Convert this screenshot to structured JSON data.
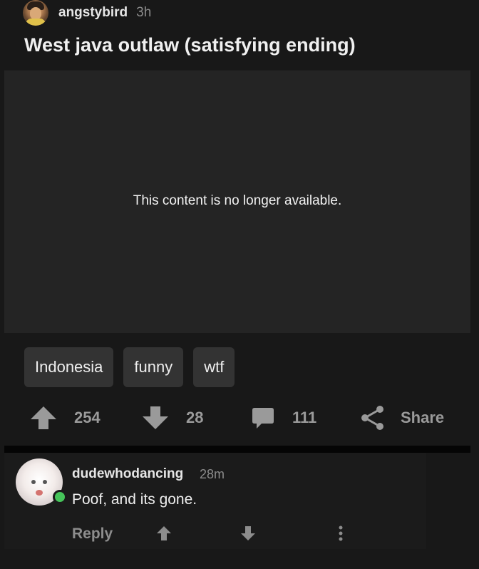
{
  "post": {
    "author": "angstybird",
    "time": "3h",
    "title": "West java outlaw (satisfying ending)",
    "media_message": "This content is no longer available.",
    "tags": [
      "Indonesia",
      "funny",
      "wtf"
    ],
    "upvotes": "254",
    "downvotes": "28",
    "comments": "111",
    "share_label": "Share"
  },
  "comment": {
    "author": "dudewhodancing",
    "time": "28m",
    "body": "Poof, and its gone.",
    "reply_label": "Reply",
    "online": true
  },
  "icons": {
    "upvote": "arrow-up-icon",
    "downvote": "arrow-down-icon",
    "comment": "speech-bubble-icon",
    "share": "share-icon",
    "more": "vertical-ellipsis-icon"
  },
  "colors": {
    "background": "#181818",
    "media_bg": "#242424",
    "tag_bg": "#333333",
    "muted_text": "#9a9a9a",
    "online_indicator": "#46c45a"
  }
}
